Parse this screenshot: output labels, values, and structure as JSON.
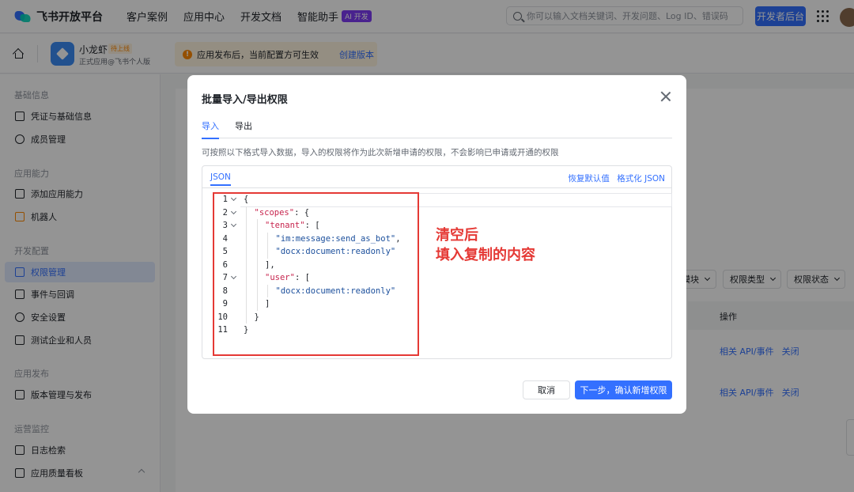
{
  "topnav": {
    "brand": "飞书开放平台",
    "items": [
      "客户案例",
      "应用中心",
      "开发文档",
      "智能助手"
    ],
    "ai_badge": "AI 开发",
    "search_placeholder": "你可以输入文档关键词、开发问题、Log ID、错误码",
    "dev_console": "开发者后台"
  },
  "app_header": {
    "app_name": "小龙虾",
    "status_badge": "待上线",
    "subtitle": "正式应用@飞书个人版",
    "notice": "应用发布后，当前配置方可生效",
    "notice_link": "创建版本"
  },
  "sidebar": {
    "groups": [
      "基础信息",
      "应用能力",
      "开发配置",
      "应用发布",
      "运营监控"
    ],
    "items": [
      "凭证与基础信息",
      "成员管理",
      "添加应用能力",
      "机器人",
      "权限管理",
      "事件与回调",
      "安全设置",
      "测试企业和人员",
      "版本管理与发布",
      "日志检索",
      "应用质量看板"
    ],
    "active": "权限管理"
  },
  "background": {
    "filters": [
      "模块",
      "权限类型",
      "权限状态"
    ],
    "table_header_op": "操作",
    "row_link_1": "相关 API/事件",
    "row_link_2": "关闭"
  },
  "modal": {
    "title": "批量导入/导出权限",
    "tabs": [
      "导入",
      "导出"
    ],
    "active_tab": "导入",
    "description": "可按照以下格式导入数据，导入的权限将作为此次新增申请的权限，不会影响已申请或开通的权限",
    "editor_tab": "JSON",
    "restore_default": "恢复默认值",
    "format_json": "格式化 JSON",
    "code": [
      {
        "n": "1",
        "indent": 0,
        "text": "{",
        "fold": true
      },
      {
        "n": "2",
        "indent": 1,
        "key": "\"scopes\"",
        "rest": ": {",
        "fold": true
      },
      {
        "n": "3",
        "indent": 2,
        "key": "\"tenant\"",
        "rest": ": [",
        "fold": true
      },
      {
        "n": "4",
        "indent": 3,
        "val": "\"im:message:send_as_bot\"",
        "rest": ","
      },
      {
        "n": "5",
        "indent": 3,
        "val": "\"docx:document:readonly\""
      },
      {
        "n": "6",
        "indent": 2,
        "text": "],"
      },
      {
        "n": "7",
        "indent": 2,
        "key": "\"user\"",
        "rest": ": [",
        "fold": true
      },
      {
        "n": "8",
        "indent": 3,
        "val": "\"docx:document:readonly\""
      },
      {
        "n": "9",
        "indent": 2,
        "text": "]"
      },
      {
        "n": "10",
        "indent": 1,
        "text": "}"
      },
      {
        "n": "11",
        "indent": 0,
        "text": "}"
      }
    ],
    "cancel": "取消",
    "confirm": "下一步，确认新增权限"
  },
  "annotation": {
    "line1": "清空后",
    "line2": "填入复制的内容",
    "color": "#e53935"
  },
  "colors": {
    "primary": "#3370ff",
    "warning": "#ff8800"
  }
}
